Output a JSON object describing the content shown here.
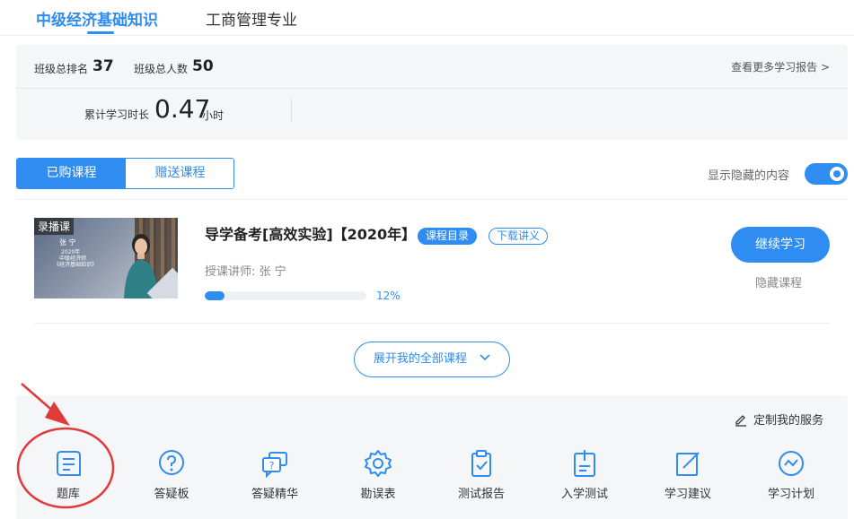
{
  "top_tabs": {
    "active": "中级经济基础知识",
    "other": "工商管理专业"
  },
  "stats": {
    "rank_label": "班级总排名",
    "rank_value": "37",
    "total_label": "班级总人数",
    "total_value": "50",
    "more_report": "查看更多学习报告 >",
    "hours_label": "累计学习时长",
    "hours_value": "0.47",
    "hours_unit": "小时"
  },
  "course_tabs": {
    "purchased": "已购课程",
    "gifted": "赠送课程"
  },
  "show_hidden_label": "显示隐藏的内容",
  "course": {
    "thumb_badge": "录播课",
    "thumb_teacher": "张 宁",
    "thumb_year": "2020年",
    "thumb_series": "中级经济师",
    "thumb_subject": "《经济基础知识》",
    "title": "导学备考[高效实验]【2020年】",
    "catalog_pill": "课程目录",
    "download_pill": "下载讲义",
    "lecturer": "授课讲师:  张   宁",
    "progress_percent": 12,
    "progress_label": "12%",
    "continue_button": "继续学习",
    "hide_button": "隐藏课程"
  },
  "expand_button": "展开我的全部课程",
  "customize_service": "定制我的服务",
  "services": [
    {
      "label": "题库",
      "icon": "question-bank-icon"
    },
    {
      "label": "答疑板",
      "icon": "qa-board-icon"
    },
    {
      "label": "答疑精华",
      "icon": "qa-highlights-icon"
    },
    {
      "label": "勘误表",
      "icon": "errata-gear-icon"
    },
    {
      "label": "测试报告",
      "icon": "test-report-icon"
    },
    {
      "label": "入学测试",
      "icon": "entrance-test-icon"
    },
    {
      "label": "学习建议",
      "icon": "study-advice-icon"
    },
    {
      "label": "学习计划",
      "icon": "study-plan-icon"
    }
  ],
  "colors": {
    "accent": "#2f8cf0",
    "panel_bg": "#f5f6f8",
    "annotation": "#e03a3a"
  }
}
